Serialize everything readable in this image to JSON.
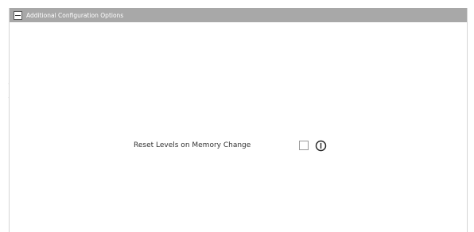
{
  "panel": {
    "title": "Additional Configuration Options",
    "collapse_icon": "minus-icon"
  },
  "option": {
    "label": "Reset Levels on Memory Change",
    "checked": false,
    "info_icon": "info-icon"
  },
  "colors": {
    "header_bg": "#a8a8a8",
    "header_text": "#ffffff",
    "label_text": "#333333"
  }
}
